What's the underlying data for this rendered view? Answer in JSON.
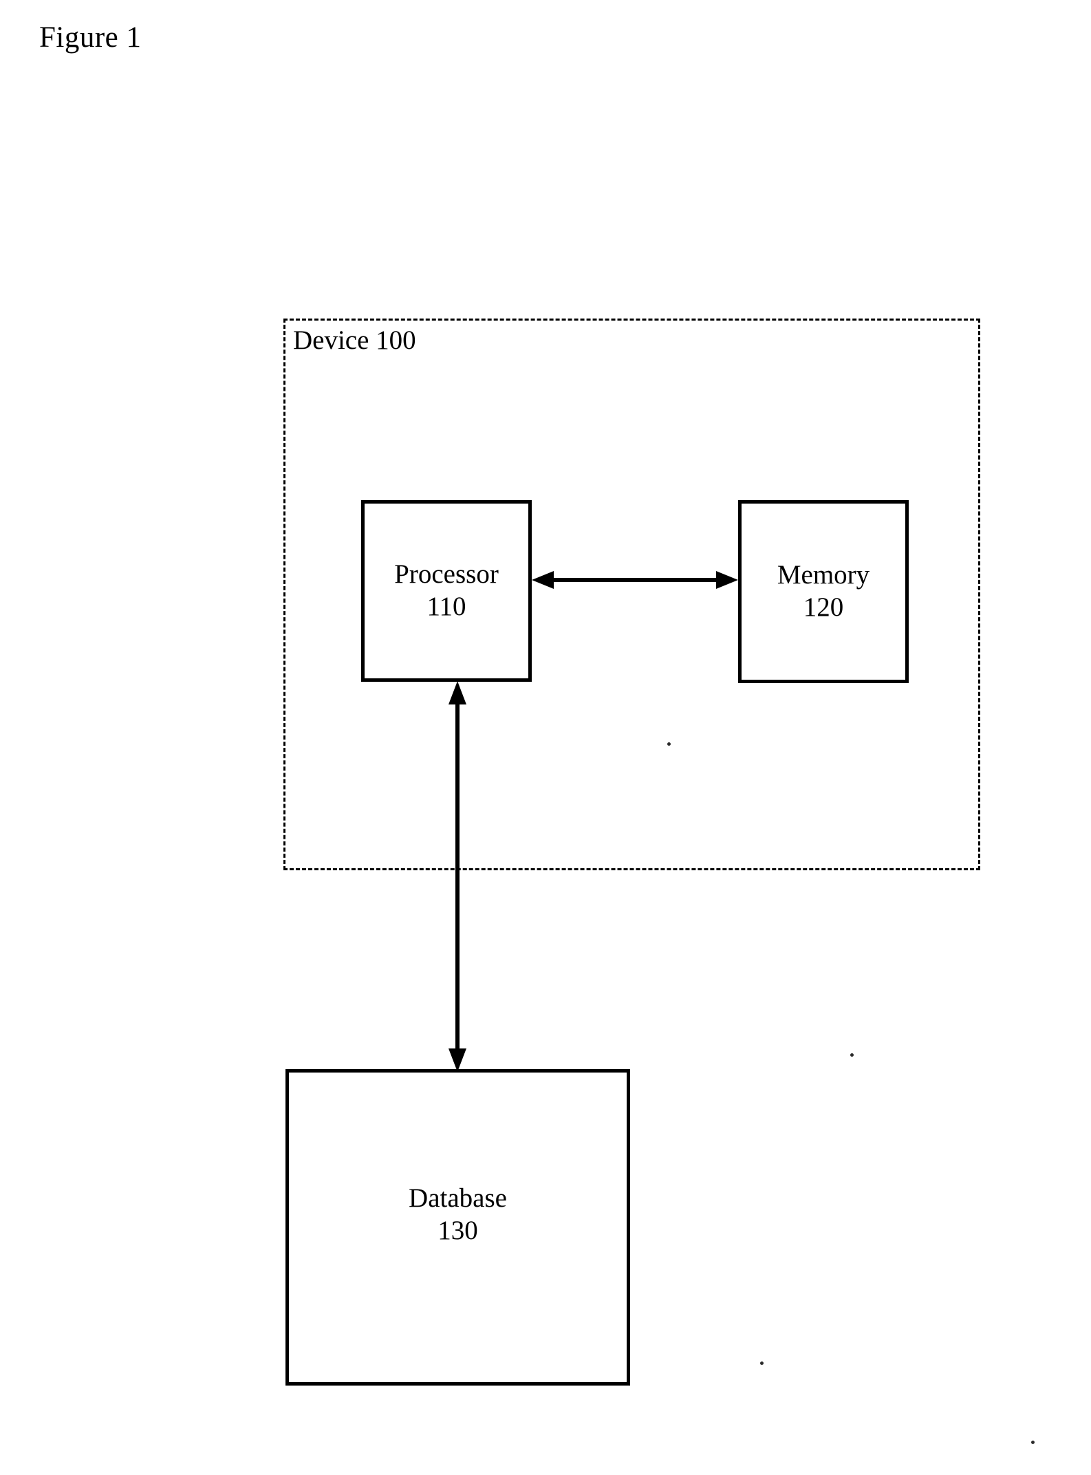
{
  "figure": {
    "title": "Figure 1"
  },
  "device_boundary": {
    "label": "Device 100",
    "style": "dashed",
    "color": "#000000"
  },
  "blocks": [
    {
      "id": "processor",
      "name": "Processor",
      "number": "110"
    },
    {
      "id": "memory",
      "name": "Memory",
      "number": "120"
    },
    {
      "id": "database",
      "name": "Database",
      "number": "130"
    }
  ],
  "connectors": [
    {
      "id": "processor-memory",
      "from": "Processor 110",
      "to": "Memory 120",
      "direction": "bidirectional",
      "orientation": "horizontal"
    },
    {
      "id": "processor-database",
      "from": "Processor 110",
      "to": "Database 130",
      "direction": "bidirectional",
      "orientation": "vertical"
    }
  ],
  "colors": {
    "ink": "#000000",
    "paper": "#ffffff"
  }
}
